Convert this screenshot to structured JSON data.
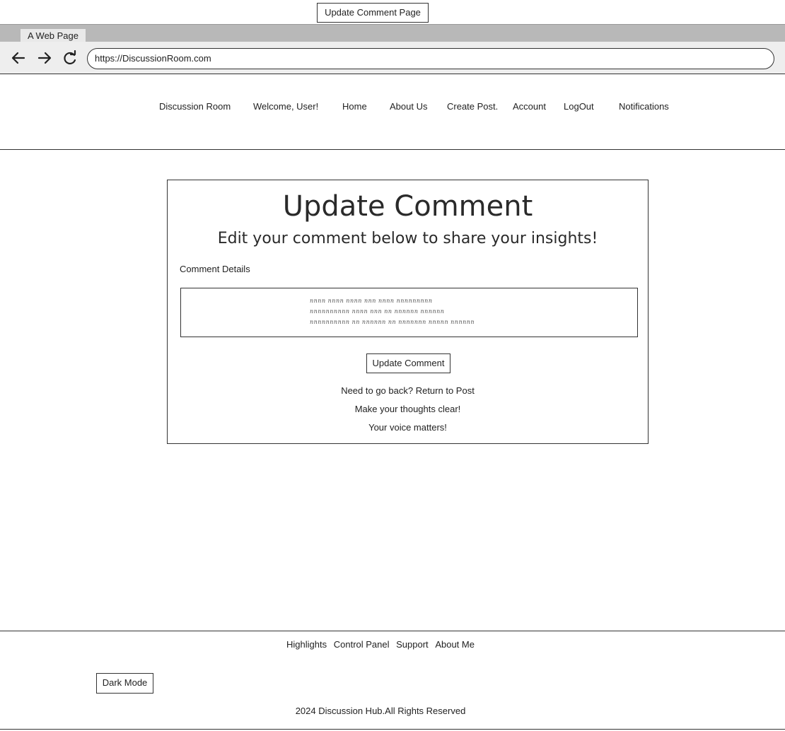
{
  "page_label": "Update Comment  Page",
  "browser": {
    "tab_label": "A Web Page",
    "url": "https://DiscussionRoom.com",
    "back_icon": "arrow-left-icon",
    "forward_icon": "arrow-right-icon",
    "reload_icon": "reload-icon"
  },
  "header": {
    "nav": [
      "Discussion Room",
      "Welcome, User!",
      "Home",
      "About Us",
      "Create Post.",
      "Account",
      "LogOut",
      "Notifications"
    ]
  },
  "main": {
    "title": "Update Comment",
    "subtitle": "Edit your comment below to share your insights!",
    "field_label": "Comment Details",
    "comment_lines": [
      "nnnn nnnn nnnn nnn nnnn nnnnnnnnn",
      "nnnnnnnnnn nnnn nnn nn nnnnnn nnnnnn",
      "nnnnnnnnnn nn nnnnnn nn nnnnnnn nnnnn nnnnnn"
    ],
    "submit_label": "Update Comment",
    "back_text": "Need to go back? Return to Post",
    "line2": "Make your thoughts clear!",
    "line3": "Your voice matters!"
  },
  "footer": {
    "links": [
      "Highlights",
      "Control Panel",
      "Support",
      "About Me"
    ],
    "dark_mode_label": "Dark Mode",
    "copyright": "2024 Discussion Hub.All Rights Reserved"
  }
}
